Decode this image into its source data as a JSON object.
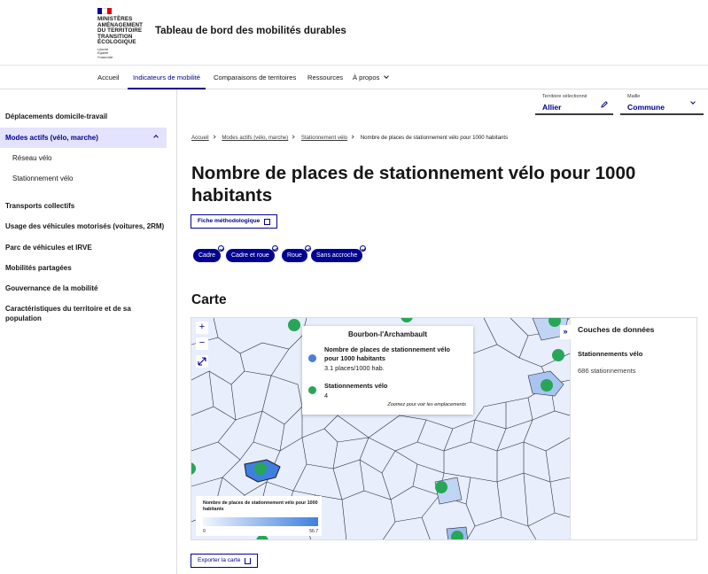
{
  "brand": {
    "logo_lines": [
      "MINISTÈRES",
      "AMÉNAGEMENT",
      "DU TERRITOIRE",
      "TRANSITION",
      "ÉCOLOGIQUE"
    ],
    "motto_lines": [
      "Liberté",
      "Égalité",
      "Fraternité"
    ],
    "site_title": "Tableau de bord des mobilités durables",
    "colors": {
      "blue": "#000091",
      "red": "#e1000f"
    }
  },
  "nav": {
    "items": [
      {
        "label": "Accueil"
      },
      {
        "label": "Indicateurs de mobilité"
      },
      {
        "label": "Comparaisons de territoires"
      },
      {
        "label": "Ressources"
      },
      {
        "label": "À propos"
      }
    ],
    "active": "Indicateurs de mobilité"
  },
  "selectors": {
    "territory": {
      "label": "Territoire sélectionné",
      "value": "Allier"
    },
    "maille": {
      "label": "Maille",
      "value": "Commune"
    }
  },
  "sidebar": {
    "items": [
      {
        "label": "Déplacements domicile-travail"
      },
      {
        "label": "Modes actifs (vélo, marche)"
      },
      {
        "label": "Transports collectifs"
      },
      {
        "label": "Usage des véhicules motorisés (voitures, 2RM)"
      },
      {
        "label": "Parc de véhicules et IRVE"
      },
      {
        "label": "Mobilités partagées"
      },
      {
        "label": "Gouvernance de la mobilité"
      },
      {
        "label": "Caractéristiques du territoire et de sa population"
      }
    ],
    "subitems": [
      {
        "label": "Réseau vélo"
      },
      {
        "label": "Stationnement vélo"
      }
    ]
  },
  "breadcrumb": {
    "items": [
      "Accueil",
      "Modes actifs (vélo, marche)",
      "Stationnement vélo"
    ],
    "current": "Nombre de places de stationnement vélo pour 1000 habitants"
  },
  "page": {
    "title": "Nombre de places de stationnement vélo pour 1000 habitants",
    "fiche_button": "Fiche méthodologique",
    "tags": [
      "Cadre",
      "Cadre et roue",
      "Roue",
      "Sans accroche"
    ],
    "section_title": "Carte",
    "export_button": "Exporter la carte"
  },
  "map": {
    "zoom_in": "+",
    "zoom_out": "−",
    "tooltip": {
      "title": "Bourbon-l'Archambault",
      "metric_label": "Nombre de places de stationnement vélo pour 1000 habitants",
      "metric_value": "3.1 places/1000 hab.",
      "stations_label": "Stationnements vélo",
      "stations_value": "4",
      "hint": "Zoomez pour voir les emplacements",
      "colors": {
        "metric": "#4a7fd6",
        "stations": "#27a658"
      }
    },
    "legend": {
      "title": "Nombre de places de stationnement vélo pour 1000 habitants",
      "min": "0",
      "max": "56.7"
    },
    "layers": {
      "toggle": "»",
      "title": "Couches de données",
      "layer_name": "Stationnements vélo",
      "layer_count": "686 stationnements"
    }
  }
}
